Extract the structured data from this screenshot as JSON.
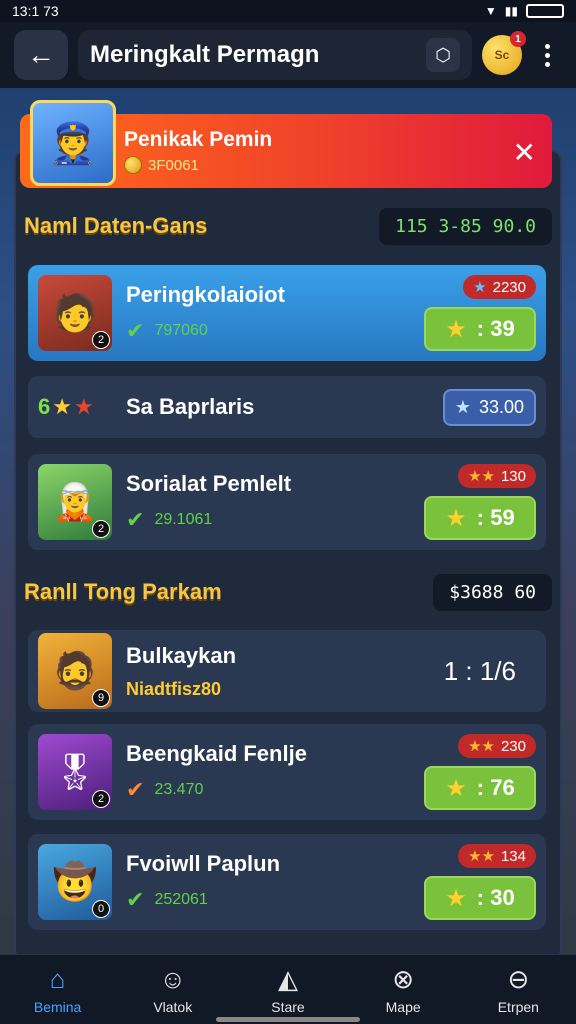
{
  "status": {
    "time": "13:1 73"
  },
  "topbar": {
    "title": "Meringkalt Permagn",
    "coin_badge": "1",
    "coin_label": "Sc"
  },
  "banner": {
    "name": "Penikak Pemin",
    "coins": "3F0061"
  },
  "section1": {
    "title": "Naml Daten-Gans",
    "value": "115 3-85 90.0"
  },
  "cards1": [
    {
      "name": "Peringkolaioiot",
      "sub": "797060",
      "pill": "2230",
      "score": ": 39",
      "lvl": "2"
    },
    {
      "name": "Sa Baprlaris",
      "chip": "33.00",
      "badge": "6"
    },
    {
      "name": "Sorialat Pemlelt",
      "sub": "29.1061",
      "pill": "130",
      "score": ": 59",
      "lvl": "2"
    }
  ],
  "section2": {
    "title": "Ranll Tong Parkam",
    "value": "$3688 60"
  },
  "cards2": [
    {
      "name": "Bulkaykan",
      "sub": "Niadtfisz80",
      "ratio": "1 : 1/6",
      "lvl": "9"
    },
    {
      "name": "Beengkaid Fenlje",
      "sub": "23.470",
      "pill": "230",
      "score": ": 76",
      "lvl": "2"
    },
    {
      "name": "Fvoiwll Paplun",
      "sub": "252061",
      "pill": "134",
      "score": ": 30",
      "lvl": "0"
    }
  ],
  "nav": [
    {
      "label": "Bemina",
      "icon": "home-icon"
    },
    {
      "label": "Vlatok",
      "icon": "user-icon"
    },
    {
      "label": "Stare",
      "icon": "store-icon"
    },
    {
      "label": "Mape",
      "icon": "map-icon"
    },
    {
      "label": "Etrpen",
      "icon": "settings-icon"
    }
  ]
}
